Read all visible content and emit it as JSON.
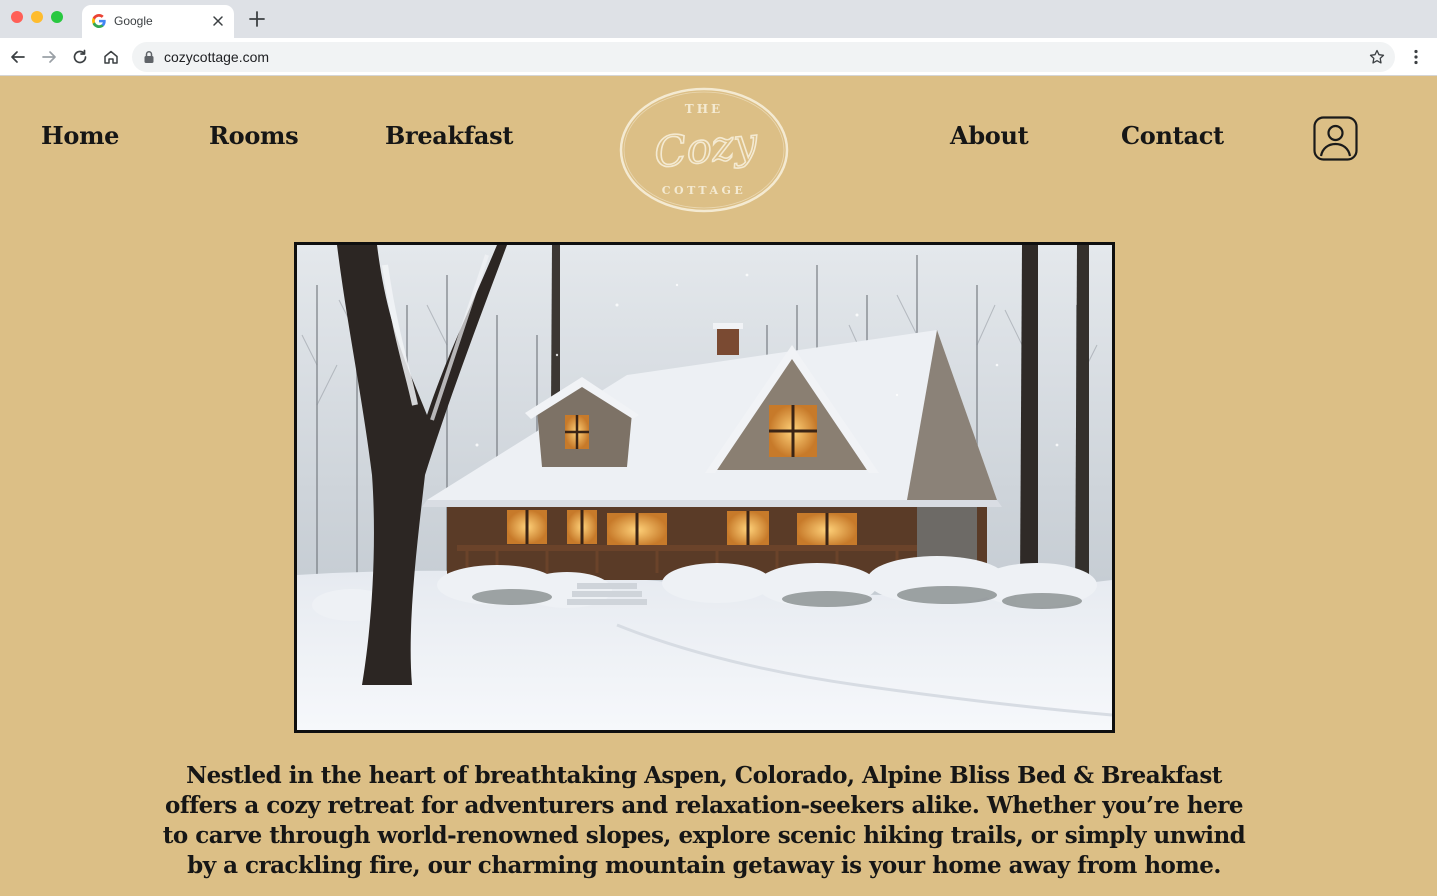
{
  "browser": {
    "tab_title": "Google",
    "url": "cozycottage.com",
    "icons": {
      "favicon": "google-favicon-icon",
      "close": "close-icon",
      "new_tab": "plus-icon",
      "back": "back-arrow-icon",
      "forward": "forward-arrow-icon",
      "reload": "reload-icon",
      "home": "home-icon",
      "lock": "lock-icon",
      "bookmark": "star-icon",
      "menu": "kebab-menu-icon"
    }
  },
  "site": {
    "nav": {
      "home": "Home",
      "rooms": "Rooms",
      "breakfast": "Breakfast",
      "about": "About",
      "contact": "Contact"
    },
    "logo": {
      "top": "THE",
      "script": "Cozy",
      "bottom": "COTTAGE"
    },
    "account_icon": "user-account-icon",
    "intro": "Nestled in the heart of breathtaking Aspen, Colorado, Alpine Bliss Bed & Breakfast offers a cozy retreat for adventurers and relaxation-seekers alike. Whether you’re here to carve through world-renowned slopes, explore scenic hiking trails, or simply unwind by a crackling fire, our charming mountain getaway is your home away from home."
  },
  "colors": {
    "page_background": "#dcbf86",
    "text": "#161616",
    "logo_cream": "#f4ead2"
  }
}
